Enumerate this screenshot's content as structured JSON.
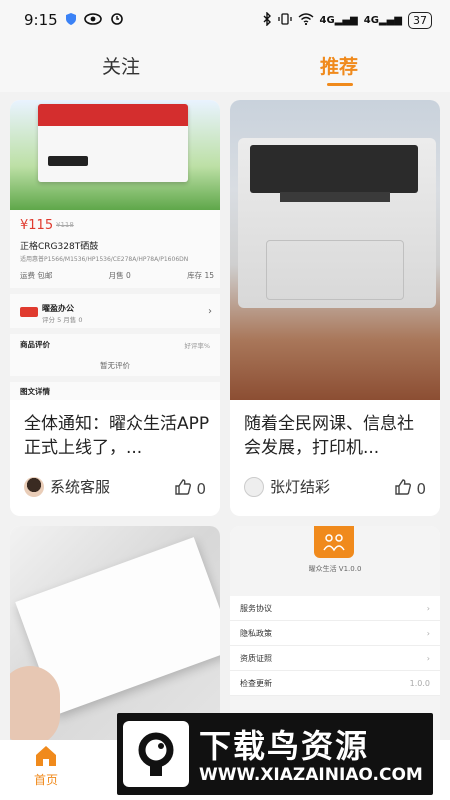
{
  "status_bar": {
    "time": "9:15",
    "battery": "37",
    "signal_1": "4G",
    "signal_2": "4G"
  },
  "tabs": {
    "follow": "关注",
    "recommend": "推荐"
  },
  "product": {
    "price": "¥115",
    "price_old": "¥118",
    "title": "正格CRG328T硒鼓",
    "subtitle": "适用惠普P1566/M1536/HP1536/CE278A/HP78A/P1606DN",
    "meta_1": "运费",
    "meta_1_value": "包邮",
    "meta_2": "月售",
    "meta_2_value": "0",
    "meta_3": "库存",
    "meta_3_value": "15",
    "shop_name": "曜盈办公",
    "shop_rating": "评分 5 月售 0",
    "review_title": "商品评价",
    "review_rate": "好评率%",
    "review_empty": "暂无评价",
    "detail_title": "图文详情"
  },
  "posts": [
    {
      "caption": "全体通知：曜众生活APP正式上线了，...",
      "author": "系统客服",
      "likes": "0"
    },
    {
      "caption": "随着全民网课、信息社会发展，打印机...",
      "author": "张灯结彩",
      "likes": "0"
    }
  ],
  "settings_shot": {
    "version": "曜众生活 V1.0.0",
    "rows": [
      {
        "label": "服务协议",
        "right": "›"
      },
      {
        "label": "隐私政策",
        "right": "›"
      },
      {
        "label": "资质证照",
        "right": "›"
      },
      {
        "label": "检查更新",
        "right": "1.0.0"
      }
    ]
  },
  "bottom_nav": {
    "home": "首页"
  },
  "watermark": {
    "title": "下载鸟资源",
    "url": "WWW.XIAZAINIAO.COM"
  },
  "colors": {
    "accent": "#f08a1c",
    "price": "#e03b2f"
  }
}
